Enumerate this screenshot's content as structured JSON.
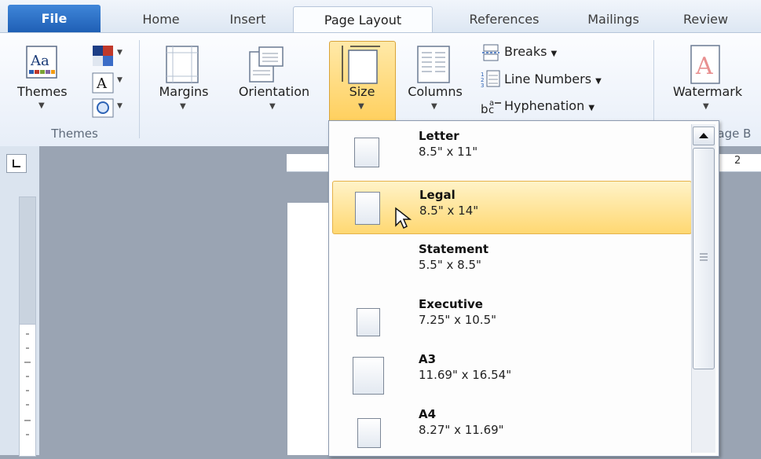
{
  "tabs": [
    {
      "label": "File"
    },
    {
      "label": "Home"
    },
    {
      "label": "Insert"
    },
    {
      "label": "Page Layout"
    },
    {
      "label": "References"
    },
    {
      "label": "Mailings"
    },
    {
      "label": "Review"
    }
  ],
  "ribbon": {
    "themes_label": "Themes",
    "themes_group": "Themes",
    "margins_label": "Margins",
    "orientation_label": "Orientation",
    "size_label": "Size",
    "columns_label": "Columns",
    "breaks_label": "Breaks",
    "line_numbers_label": "Line Numbers",
    "hyphenation_label": "Hyphenation",
    "watermark_label": "Watermark",
    "page_background_group": "Page B"
  },
  "ruler": {
    "tick_label": "2"
  },
  "size_menu": {
    "items": [
      {
        "name": "Letter",
        "dims": "8.5\" x 11\""
      },
      {
        "name": "Legal",
        "dims": "8.5\" x 14\""
      },
      {
        "name": "Statement",
        "dims": "5.5\" x 8.5\""
      },
      {
        "name": "Executive",
        "dims": "7.25\" x 10.5\""
      },
      {
        "name": "A3",
        "dims": "11.69\" x 16.54\""
      },
      {
        "name": "A4",
        "dims": "8.27\" x 11.69\""
      }
    ],
    "hovered_index": 1
  },
  "colors": {
    "file_tab": "#2a6fc4",
    "hover_fill": "#ffd872",
    "ribbon_bg": "#e7eef8"
  }
}
